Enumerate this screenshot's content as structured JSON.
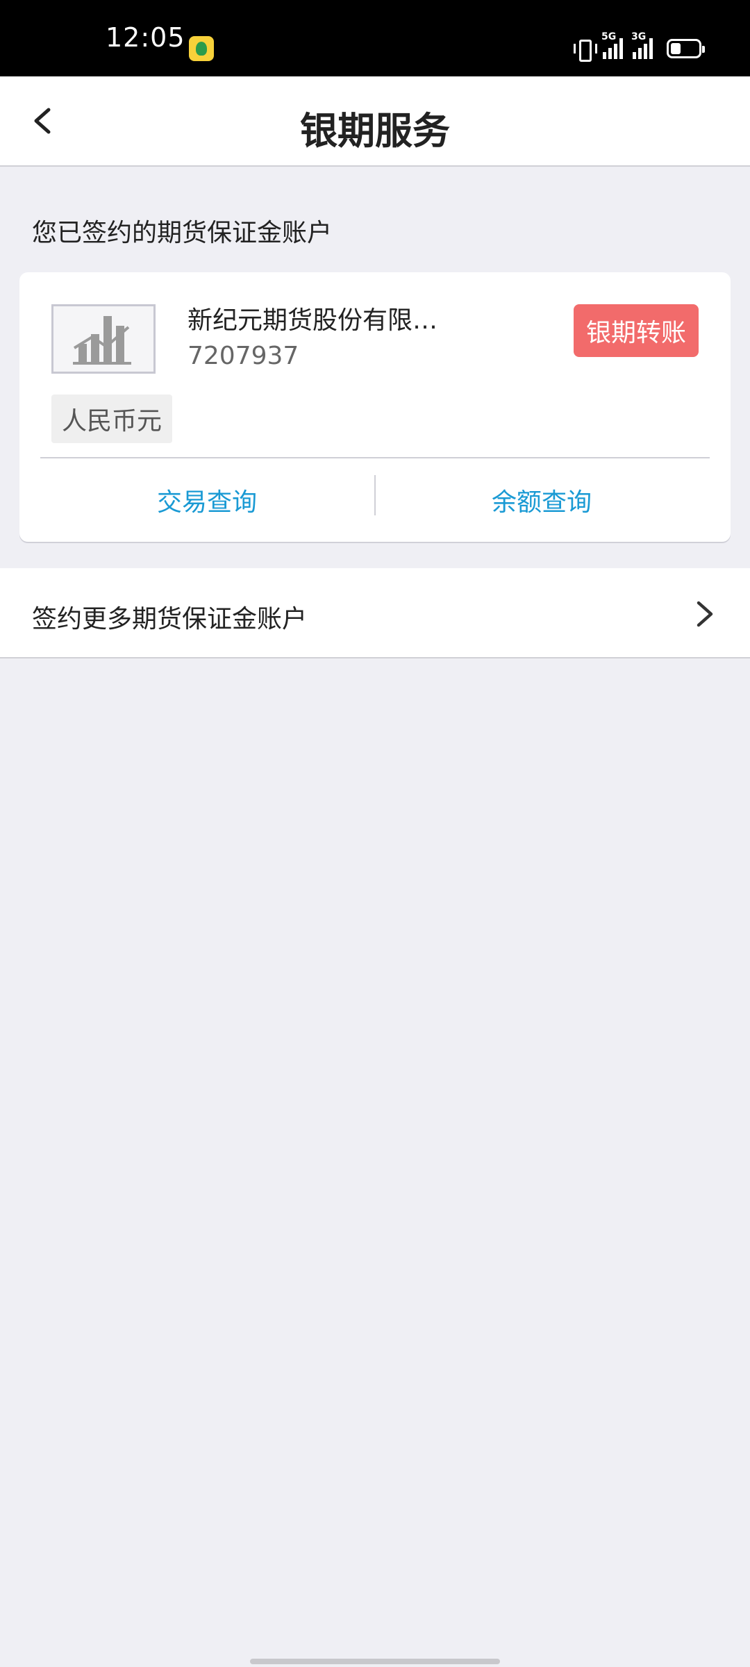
{
  "status_bar": {
    "time": "12:05",
    "network_5g": "5G",
    "network_3g": "3G"
  },
  "header": {
    "title": "银期服务"
  },
  "section": {
    "title": "您已签约的期货保证金账户"
  },
  "account": {
    "name": "新纪元期货股份有限…",
    "number": "7207937",
    "currency": "人民币元",
    "transfer_label": "银期转账",
    "transaction_query_label": "交易查询",
    "balance_query_label": "余额查询"
  },
  "more": {
    "label": "签约更多期货保证金账户"
  },
  "colors": {
    "accent_blue": "#1a9ad4",
    "transfer_red": "#f26b6b",
    "background": "#efeff4"
  }
}
